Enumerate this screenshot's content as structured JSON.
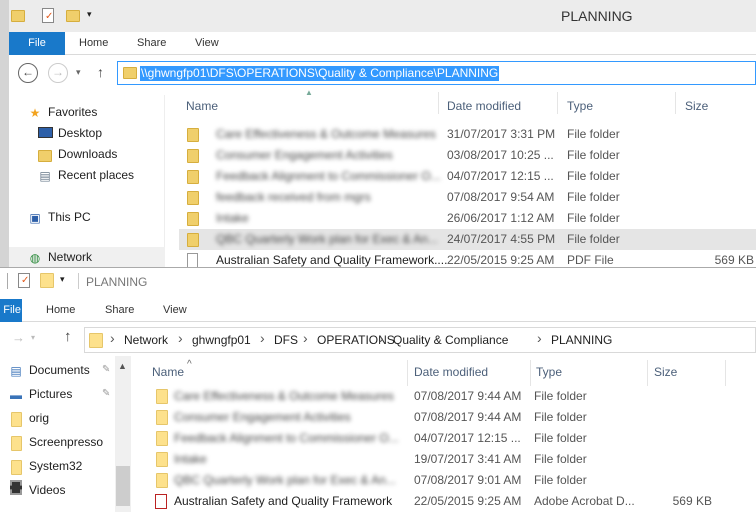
{
  "top_window": {
    "title": "PLANNING",
    "tabs": [
      "File",
      "Home",
      "Share",
      "View"
    ],
    "address": "\\\\ghwngfp01\\DFS\\OPERATIONS\\Quality & Compliance\\PLANNING",
    "nav": [
      {
        "label": "Favorites",
        "icon": "star-icon"
      },
      {
        "label": "Desktop",
        "icon": "desktop-icon"
      },
      {
        "label": "Downloads",
        "icon": "downloads-icon"
      },
      {
        "label": "Recent places",
        "icon": "recent-places-icon"
      },
      {
        "label": "This PC",
        "icon": "pc-icon"
      },
      {
        "label": "Network",
        "icon": "network-icon"
      }
    ],
    "columns": [
      "Name",
      "Date modified",
      "Type",
      "Size"
    ],
    "rows": [
      {
        "name": "Care Effectiveness & Outcome Measures",
        "date": "31/07/2017 3:31 PM",
        "type": "File folder",
        "size": "",
        "blurred": true
      },
      {
        "name": "Consumer Engagement Activities",
        "date": "03/08/2017 10:25 ...",
        "type": "File folder",
        "size": "",
        "blurred": true
      },
      {
        "name": "Feedback Alignment to Commissioner O...",
        "date": "04/07/2017 12:15 ...",
        "type": "File folder",
        "size": "",
        "blurred": true
      },
      {
        "name": "feedback received from mgrs",
        "date": "07/08/2017 9:54 AM",
        "type": "File folder",
        "size": "",
        "blurred": true
      },
      {
        "name": "Intake",
        "date": "26/06/2017 1:12 AM",
        "type": "File folder",
        "size": "",
        "blurred": true
      },
      {
        "name": "QBC Quarterly Work plan for Exec & An...",
        "date": "24/07/2017 4:55 PM",
        "type": "File folder",
        "size": "",
        "blurred": true
      },
      {
        "name": "Australian Safety and Quality Framework....",
        "date": "22/05/2015 9:25 AM",
        "type": "PDF File",
        "size": "569 KB",
        "blurred": false
      }
    ]
  },
  "bottom_window": {
    "title": "PLANNING",
    "tabs": [
      "File",
      "Home",
      "Share",
      "View"
    ],
    "breadcrumb": [
      "Network",
      "ghwngfp01",
      "DFS",
      "OPERATIONS",
      "Quality & Compliance",
      "PLANNING"
    ],
    "nav": [
      {
        "label": "Documents",
        "icon": "documents-icon"
      },
      {
        "label": "Pictures",
        "icon": "pictures-icon"
      },
      {
        "label": "orig",
        "icon": "folder-icon"
      },
      {
        "label": "Screenpresso",
        "icon": "folder-icon"
      },
      {
        "label": "System32",
        "icon": "folder-icon"
      },
      {
        "label": "Videos",
        "icon": "videos-icon"
      }
    ],
    "columns": [
      "Name",
      "Date modified",
      "Type",
      "Size"
    ],
    "rows": [
      {
        "name": "Care Effectiveness & Outcome Measures",
        "date": "07/08/2017 9:44 AM",
        "type": "File folder",
        "size": ""
      },
      {
        "name": "Consumer Engagement Activities",
        "date": "07/08/2017 9:44 AM",
        "type": "File folder",
        "size": ""
      },
      {
        "name": "Feedback Alignment to Commissioner O...",
        "date": "04/07/2017 12:15 ...",
        "type": "File folder",
        "size": ""
      },
      {
        "name": "Intake",
        "date": "19/07/2017 3:41 AM",
        "type": "File folder",
        "size": ""
      },
      {
        "name": "QBC Quarterly Work plan for Exec & An...",
        "date": "07/08/2017 9:01 AM",
        "type": "File folder",
        "size": ""
      },
      {
        "name": "Australian Safety and Quality Framework",
        "date": "22/05/2015 9:25 AM",
        "type": "Adobe Acrobat D...",
        "size": "569 KB"
      }
    ]
  }
}
